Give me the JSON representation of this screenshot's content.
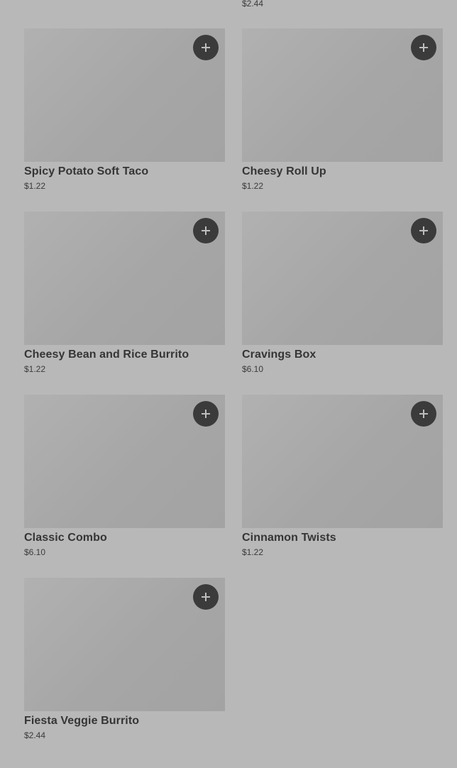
{
  "partial_item": {
    "price": "$2.44"
  },
  "items": [
    {
      "name": "Spicy Potato Soft Taco",
      "price": "$1.22"
    },
    {
      "name": "Cheesy Roll Up",
      "price": "$1.22"
    },
    {
      "name": "Cheesy Bean and Rice Burrito",
      "price": "$1.22"
    },
    {
      "name": "Cravings Box",
      "price": "$6.10"
    },
    {
      "name": "Classic Combo",
      "price": "$6.10"
    },
    {
      "name": "Cinnamon Twists",
      "price": "$1.22"
    },
    {
      "name": "Fiesta Veggie Burrito",
      "price": "$2.44"
    }
  ],
  "icons": {
    "add": "plus-icon"
  },
  "colors": {
    "background": "#b8b8b8",
    "image_placeholder": "#a8a8a8",
    "add_button": "#3b3b3b",
    "add_icon": "#bdbdbd"
  }
}
